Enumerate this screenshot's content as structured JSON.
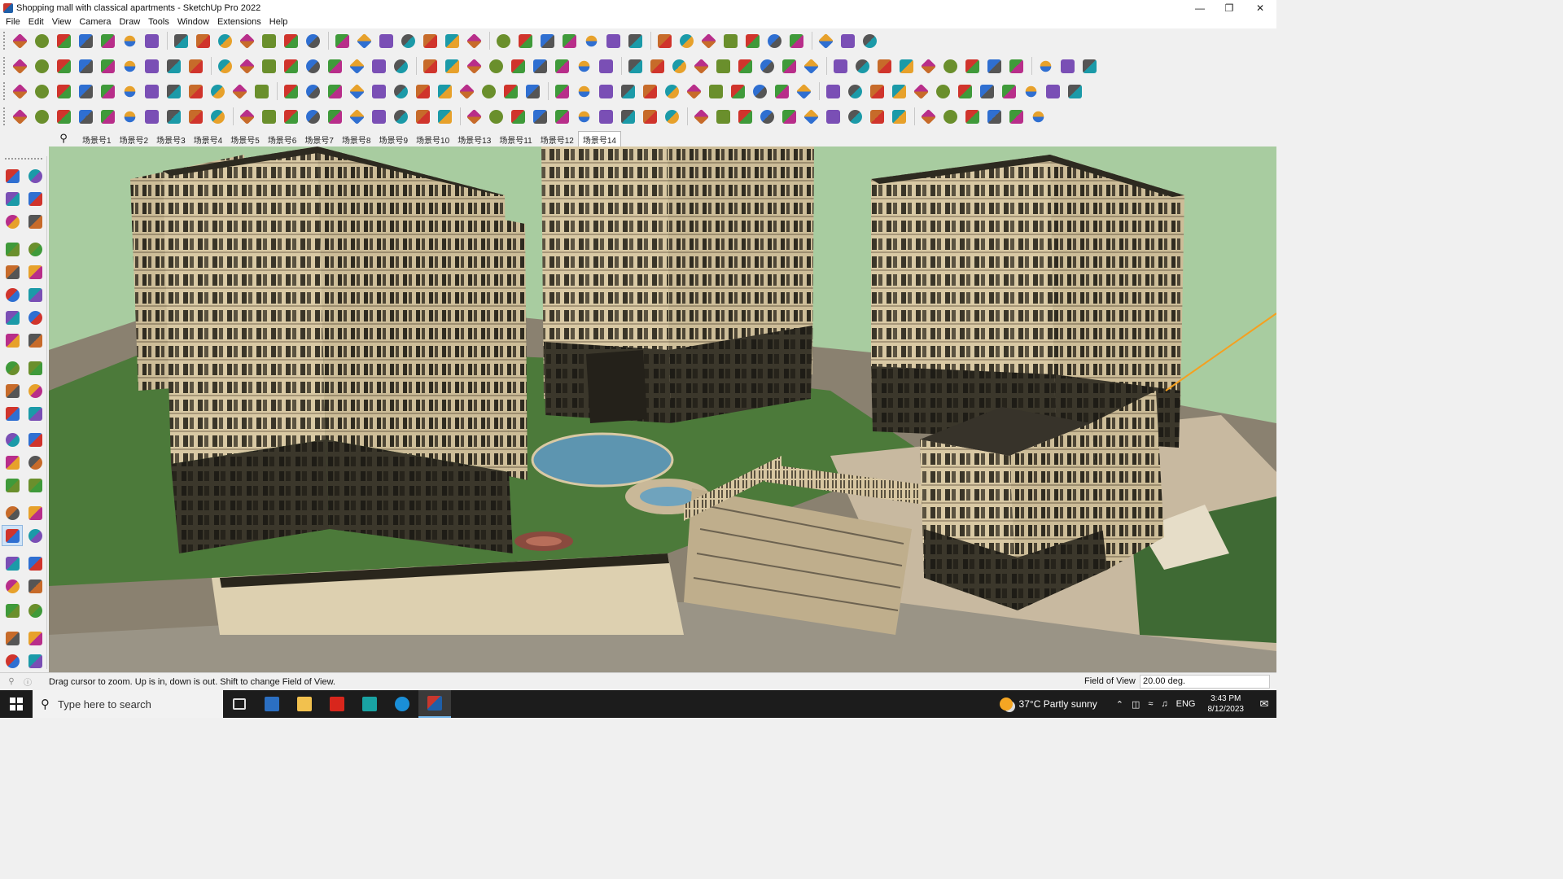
{
  "window": {
    "title": "Shopping mall with classical apartments - SketchUp Pro 2022",
    "controls": [
      "minimize",
      "restore",
      "close"
    ]
  },
  "menu": [
    "File",
    "Edit",
    "View",
    "Camera",
    "Draw",
    "Tools",
    "Window",
    "Extensions",
    "Help"
  ],
  "scenes": {
    "tabs": [
      "场景号1",
      "场景号2",
      "场景号3",
      "场景号4",
      "场景号5",
      "场景号6",
      "场景号7",
      "场景号8",
      "场景号9",
      "场景号10",
      "场景号13",
      "场景号11",
      "场景号12",
      "场景号14"
    ],
    "active_index": 13
  },
  "status": {
    "message": "Drag cursor to zoom.  Up is in, down is out. Shift to change Field of View.",
    "vcb_label": "Field of View",
    "vcb_value": "20.00 deg."
  },
  "taskbar": {
    "search_placeholder": "Type here to search",
    "weather": "37°C  Partly sunny",
    "language": "ENG",
    "time": "3:43 PM",
    "date": "8/12/2023"
  },
  "colors": {
    "sky": "#a8cca0",
    "lawn": "#4c7a3a",
    "building_wall": "#d9c9a4",
    "building_trim": "#2d2a20",
    "pond": "#5d95b0",
    "highlight_line": "#f5a020"
  }
}
